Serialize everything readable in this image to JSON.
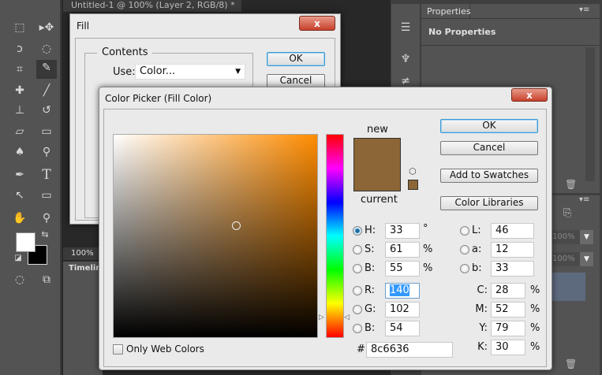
{
  "document_tab": {
    "title": "Untitled-1 @ 100% (Layer 2, RGB/8) *",
    "close": "×"
  },
  "status": {
    "zoom": "100%",
    "timeline": "Timeline"
  },
  "properties_panel": {
    "tab": "Properties",
    "content": "No Properties"
  },
  "layers_panel": {
    "opacity": "100%",
    "fill": "100%"
  },
  "fill_dialog": {
    "title": "Fill",
    "close": "x",
    "contents_label": "Contents",
    "use_label": "Use:",
    "use_value": "Color...",
    "ok": "OK",
    "cancel": "Cancel"
  },
  "color_picker": {
    "title": "Color Picker (Fill Color)",
    "close": "x",
    "new_label": "new",
    "current_label": "current",
    "new_color": "#8c6636",
    "current_color": "#8c6636",
    "ok": "OK",
    "cancel": "Cancel",
    "add_swatches": "Add to Swatches",
    "color_libraries": "Color Libraries",
    "only_web_colors": "Only Web Colors",
    "hsb": [
      {
        "label": "H:",
        "value": "33",
        "unit": "°"
      },
      {
        "label": "S:",
        "value": "61",
        "unit": "%"
      },
      {
        "label": "B:",
        "value": "55",
        "unit": "%"
      }
    ],
    "rgb": [
      {
        "label": "R:",
        "value": "140"
      },
      {
        "label": "G:",
        "value": "102"
      },
      {
        "label": "B:",
        "value": "54"
      }
    ],
    "lab": [
      {
        "label": "L:",
        "value": "46"
      },
      {
        "label": "a:",
        "value": "12"
      },
      {
        "label": "b:",
        "value": "33"
      }
    ],
    "cmyk": [
      {
        "label": "C:",
        "value": "28",
        "unit": "%"
      },
      {
        "label": "M:",
        "value": "52",
        "unit": "%"
      },
      {
        "label": "Y:",
        "value": "79",
        "unit": "%"
      },
      {
        "label": "K:",
        "value": "30",
        "unit": "%"
      }
    ],
    "hex_label": "#",
    "hex": "8c6636",
    "selected_hue_deg": 33,
    "saturation_pct": 61,
    "brightness_pct": 55
  }
}
